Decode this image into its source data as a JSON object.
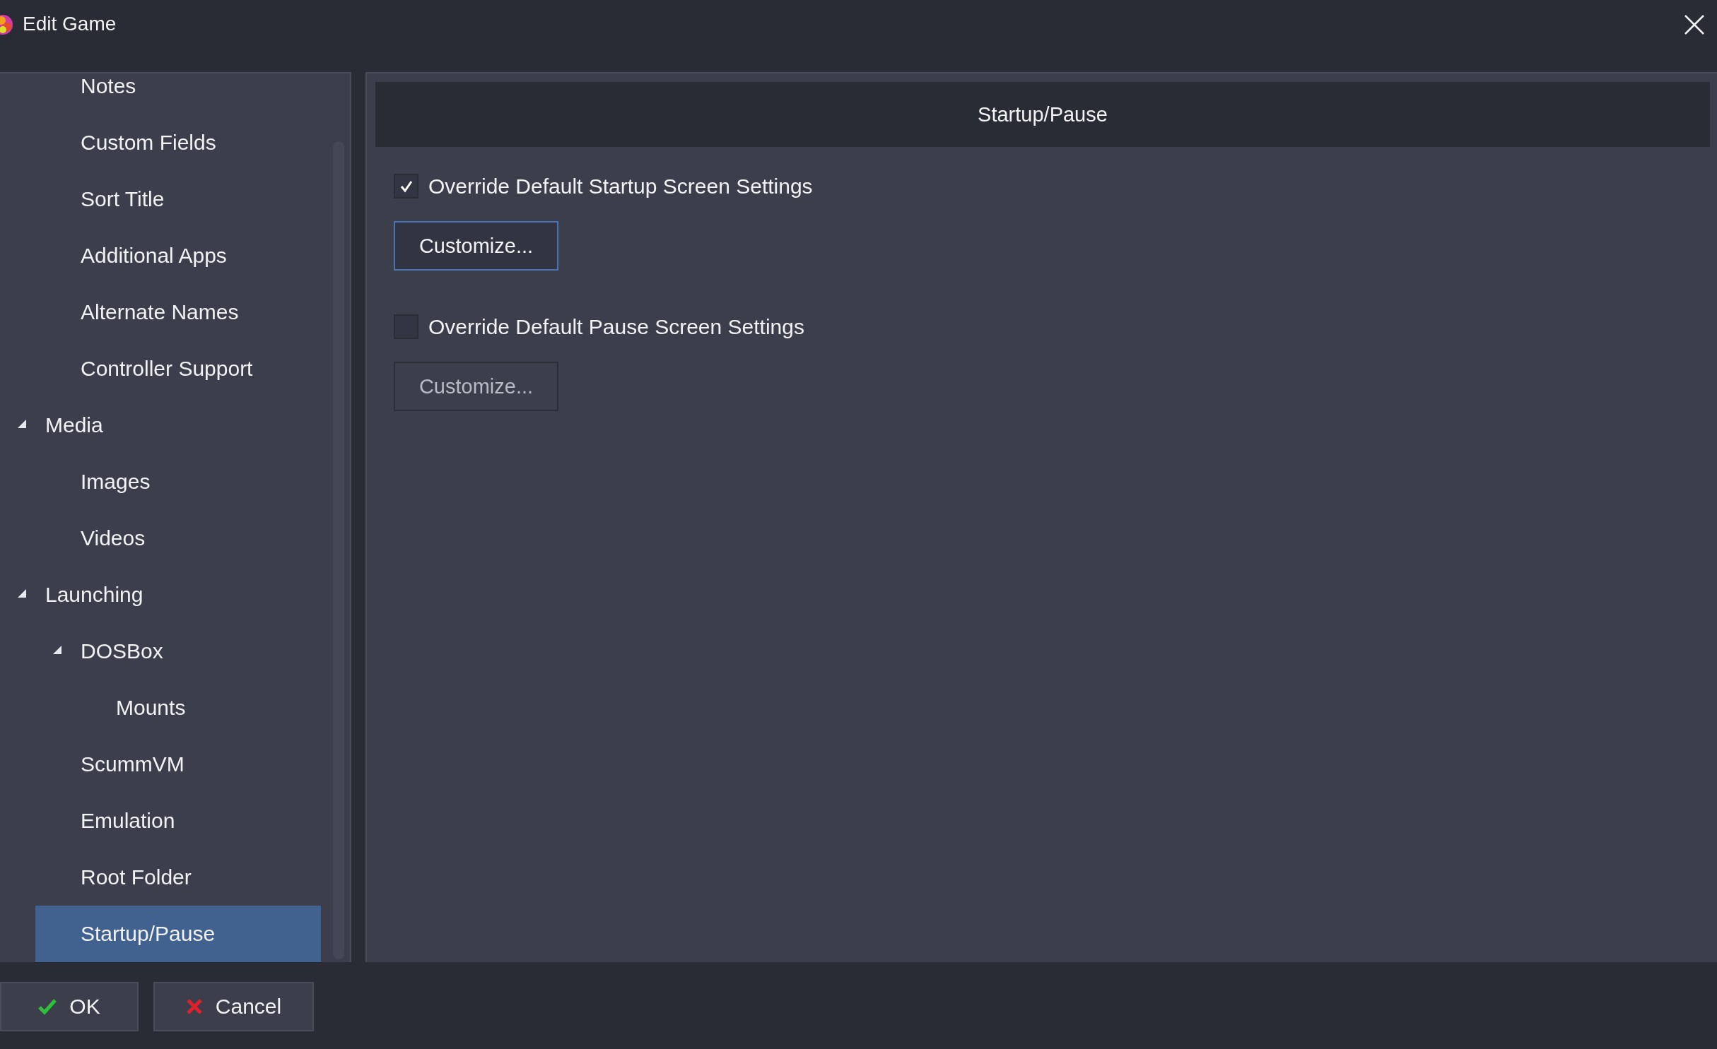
{
  "window": {
    "title": "Edit Game"
  },
  "tree": {
    "items": [
      {
        "children": [
          {
            "label": "Notes",
            "selected": false
          },
          {
            "label": "Custom Fields",
            "selected": false
          },
          {
            "label": "Sort Title",
            "selected": false
          },
          {
            "label": "Additional Apps",
            "selected": false
          },
          {
            "label": "Alternate Names",
            "selected": false
          },
          {
            "label": "Controller Support",
            "selected": false
          }
        ]
      },
      {
        "label": "Media",
        "selected": false,
        "expanded": true,
        "children": [
          {
            "label": "Images",
            "selected": false
          },
          {
            "label": "Videos",
            "selected": false
          }
        ]
      },
      {
        "label": "Launching",
        "selected": false,
        "expanded": true,
        "children": [
          {
            "label": "DOSBox",
            "selected": false,
            "expanded": true,
            "children": [
              {
                "label": "Mounts",
                "selected": false
              }
            ]
          },
          {
            "label": "ScummVM",
            "selected": false
          },
          {
            "label": "Emulation",
            "selected": false
          },
          {
            "label": "Root Folder",
            "selected": false
          },
          {
            "label": "Startup/Pause",
            "selected": true
          }
        ]
      }
    ]
  },
  "panel": {
    "header": "Startup/Pause",
    "options": [
      {
        "label": "Override Default Startup Screen Settings",
        "checked": true,
        "button": {
          "label": "Customize...",
          "focused": true,
          "disabled": false
        }
      },
      {
        "label": "Override Default Pause Screen Settings",
        "checked": false,
        "button": {
          "label": "Customize...",
          "focused": false,
          "disabled": true
        }
      }
    ]
  },
  "buttons": [
    {
      "label": "OK",
      "kind": "ok"
    },
    {
      "label": "Cancel",
      "kind": "cancel"
    }
  ]
}
